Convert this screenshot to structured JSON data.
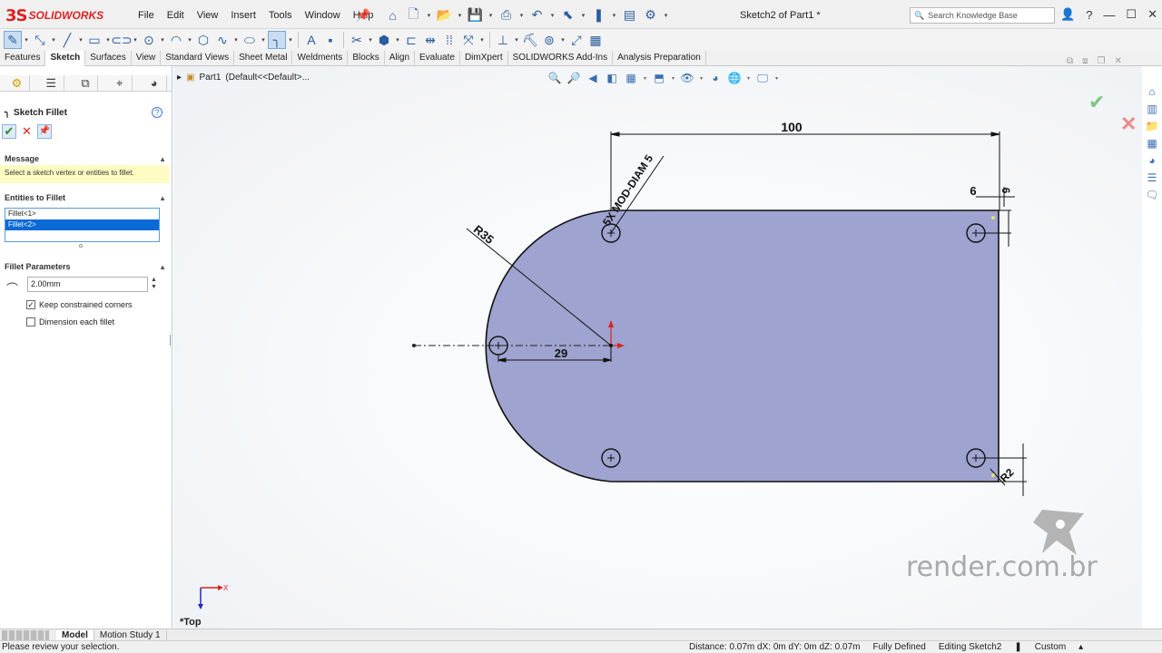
{
  "app": {
    "logo_ds": "3S",
    "logo_text": "SOLIDWORKS",
    "document_title": "Sketch2 of Part1 *",
    "menu": [
      "File",
      "Edit",
      "View",
      "Insert",
      "Tools",
      "Window",
      "Help"
    ],
    "search_placeholder": "Search Knowledge Base"
  },
  "command_tabs": [
    {
      "label": "Features",
      "active": false
    },
    {
      "label": "Sketch",
      "active": true
    },
    {
      "label": "Surfaces",
      "active": false
    },
    {
      "label": "View",
      "active": false
    },
    {
      "label": "Standard Views",
      "active": false
    },
    {
      "label": "Sheet Metal",
      "active": false
    },
    {
      "label": "Weldments",
      "active": false
    },
    {
      "label": "Blocks",
      "active": false
    },
    {
      "label": "Align",
      "active": false
    },
    {
      "label": "Evaluate",
      "active": false
    },
    {
      "label": "DimXpert",
      "active": false
    },
    {
      "label": "SOLIDWORKS Add-Ins",
      "active": false
    },
    {
      "label": "Analysis Preparation",
      "active": false
    }
  ],
  "property_manager": {
    "title": "Sketch Fillet",
    "help": "?",
    "message_header": "Message",
    "message_text": "Select a sketch vertex or entities to fillet.",
    "entities_header": "Entities to Fillet",
    "entities": [
      {
        "label": "Fillet<1>",
        "selected": false
      },
      {
        "label": "Fillet<2>",
        "selected": true
      }
    ],
    "params_header": "Fillet Parameters",
    "radius_value": "2.00mm",
    "keep_constrained_label": "Keep constrained corners",
    "keep_constrained_checked": true,
    "dimension_each_label": "Dimension each fillet",
    "dimension_each_checked": false
  },
  "graphics": {
    "breadcrumb_part": "Part1",
    "breadcrumb_config": "(Default<<Default>...",
    "view_label": "*Top",
    "triad_x": "X",
    "watermark": "render.com.br",
    "dimensions": {
      "width": "100",
      "arc_radius": "R35",
      "center_offset": "29",
      "hole_diam": "5X MOD-DIAM 5",
      "corner_offset_a": "6",
      "corner_offset_b": "6",
      "fillet_radius": "R2"
    }
  },
  "bottom_tabs": [
    {
      "label": "Model",
      "active": true
    },
    {
      "label": "Motion Study 1",
      "active": false
    }
  ],
  "status": {
    "message": "Please review your selection.",
    "distance": "Distance: 0.07m",
    "dx": "dX: 0m",
    "dy": "dY: 0m",
    "dz": "dZ: 0.07m",
    "defined": "Fully Defined",
    "editing": "Editing Sketch2",
    "units": "Custom"
  },
  "colors": {
    "brand": "#d22222",
    "sketch_fill": "#9ea3cf",
    "selection": "#0a6ad6",
    "message_bg": "#fefcc2"
  }
}
